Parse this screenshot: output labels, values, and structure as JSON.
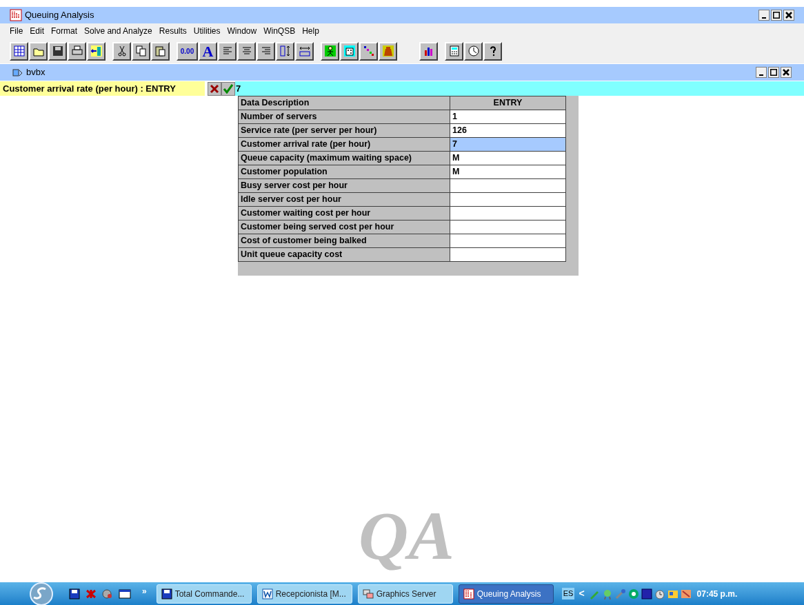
{
  "window": {
    "title": "Queuing Analysis"
  },
  "menu": [
    "File",
    "Edit",
    "Format",
    "Solve and Analyze",
    "Results",
    "Utilities",
    "Window",
    "WinQSB",
    "Help"
  ],
  "toolbar_labels": [
    "0.00",
    "A"
  ],
  "child_window": {
    "title": "bvbx"
  },
  "entry_bar": {
    "label": "Customer arrival rate (per hour) : ENTRY",
    "value": "7"
  },
  "table": {
    "columns": [
      "Data Description",
      "ENTRY"
    ],
    "rows": [
      {
        "description": "Number of servers",
        "entry": "1",
        "selected": false
      },
      {
        "description": "Service rate (per server per hour)",
        "entry": "126",
        "selected": false
      },
      {
        "description": "Customer arrival rate (per hour)",
        "entry": "7",
        "selected": true
      },
      {
        "description": "Queue capacity (maximum waiting space)",
        "entry": "M",
        "selected": false
      },
      {
        "description": "Customer population",
        "entry": "M",
        "selected": false
      },
      {
        "description": "Busy server cost per hour",
        "selected": false
      },
      {
        "description": "Idle server cost per hour",
        "selected": false
      },
      {
        "description": "Customer waiting cost per hour",
        "selected": false
      },
      {
        "description": "Customer being served cost per hour",
        "selected": false
      },
      {
        "description": "Cost of customer being balked",
        "selected": false
      },
      {
        "description": "Unit queue capacity cost",
        "selected": false
      }
    ]
  },
  "background_logo": "QA",
  "taskbar": {
    "overflow": "»",
    "tasks": [
      {
        "label": "Total Commande...",
        "selected": false
      },
      {
        "label": "Recepcionista [M...",
        "selected": false
      },
      {
        "label": "Graphics Server",
        "selected": false
      },
      {
        "label": "Queuing Analysis",
        "selected": true
      }
    ],
    "language": "ES",
    "tray_toggle": "<",
    "clock": "07:45 p.m."
  }
}
